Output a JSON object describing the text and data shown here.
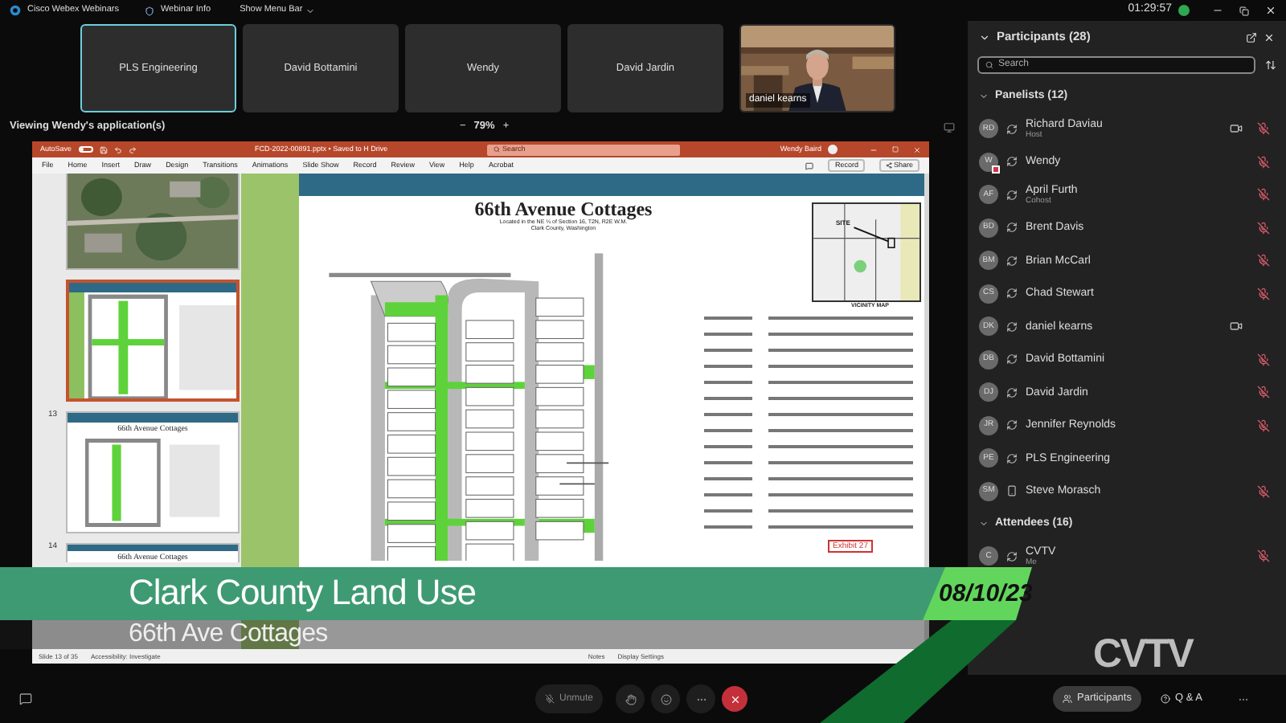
{
  "app_bar": {
    "title": "Cisco Webex Webinars",
    "info": "Webinar Info",
    "menu": "Show Menu Bar",
    "time": "01:29:57"
  },
  "video_tiles": [
    {
      "kind": "name",
      "name": "PLS Engineering",
      "selected": true
    },
    {
      "kind": "name",
      "name": "David Bottamini",
      "selected": false
    },
    {
      "kind": "name",
      "name": "Wendy",
      "selected": false
    },
    {
      "kind": "name",
      "name": "David Jardin",
      "selected": false
    },
    {
      "kind": "video",
      "name": "daniel kearns",
      "selected": false
    }
  ],
  "share_bar": {
    "label": "Viewing Wendy's application(s)",
    "zoom_out": "−",
    "zoom": "79%",
    "zoom_in": "+"
  },
  "ppt": {
    "autosave": "AutoSave",
    "autosave_on": false,
    "file": "FCD-2022-00891.pptx • Saved to H Drive",
    "search": "Search",
    "user": "Wendy Baird",
    "tabs": [
      "File",
      "Home",
      "Insert",
      "Draw",
      "Design",
      "Transitions",
      "Animations",
      "Slide Show",
      "Record",
      "Review",
      "View",
      "Help",
      "Acrobat"
    ],
    "record": "Record",
    "share": "Share",
    "thumbnails": [
      {
        "kind": "aerial",
        "selected": false
      },
      {
        "kind": "plan",
        "selected": true
      },
      {
        "kind": "title",
        "number": "13",
        "title": "66th Avenue Cottages",
        "selected": false
      },
      {
        "kind": "title",
        "number": "14",
        "title": "66th Avenue Cottages",
        "selected": false
      }
    ],
    "slide": {
      "title": "66th Avenue Cottages",
      "subtitle_1": "Located in the NE ¼ of Section 16, T2N, R2E W.M.",
      "subtitle_2": "Clark County, Washington",
      "map_label": "SITE",
      "map_caption": "VICINITY MAP",
      "exhibit": "Exhibit 27"
    },
    "status": {
      "slide": "Slide 13 of 35",
      "accessibility": "Accessibility: Investigate",
      "notes": "Notes",
      "display": "Display Settings"
    }
  },
  "panel": {
    "title": "Participants (28)",
    "search_placeholder": "Search",
    "groups": [
      {
        "label": "Panelists (12)",
        "expanded": true,
        "people": [
          {
            "initials": "RD",
            "name": "Richard Daviau",
            "role": "Host",
            "phone": false,
            "video": true,
            "muted": true,
            "sharing": false
          },
          {
            "initials": "W",
            "name": "Wendy",
            "phone": false,
            "video": false,
            "muted": true,
            "sharing": true
          },
          {
            "initials": "AF",
            "name": "April Furth",
            "role": "Cohost",
            "phone": false,
            "video": false,
            "muted": true,
            "sharing": false
          },
          {
            "initials": "BD",
            "name": "Brent Davis",
            "phone": false,
            "video": false,
            "muted": true,
            "sharing": false
          },
          {
            "initials": "BM",
            "name": "Brian McCarl",
            "phone": false,
            "video": false,
            "muted": true,
            "sharing": false
          },
          {
            "initials": "CS",
            "name": "Chad Stewart",
            "phone": false,
            "video": false,
            "muted": true,
            "sharing": false
          },
          {
            "initials": "DK",
            "name": "daniel kearns",
            "phone": false,
            "video": true,
            "muted": false,
            "sharing": false
          },
          {
            "initials": "DB",
            "name": "David Bottamini",
            "phone": false,
            "video": false,
            "muted": true,
            "sharing": false
          },
          {
            "initials": "DJ",
            "name": "David Jardin",
            "phone": false,
            "video": false,
            "muted": true,
            "sharing": false
          },
          {
            "initials": "JR",
            "name": "Jennifer Reynolds",
            "phone": false,
            "video": false,
            "muted": true,
            "sharing": false
          },
          {
            "initials": "PE",
            "name": "PLS Engineering",
            "phone": false,
            "video": false,
            "muted": false,
            "sharing": false
          },
          {
            "initials": "SM",
            "name": "Steve Morasch",
            "phone": true,
            "video": false,
            "muted": true,
            "sharing": false
          }
        ]
      },
      {
        "label": "Attendees (16)",
        "expanded": true,
        "people": [
          {
            "initials": "C",
            "name": "CVTV",
            "role": "Me",
            "phone": false,
            "video": false,
            "muted": true,
            "sharing": false
          }
        ]
      }
    ]
  },
  "controls": {
    "unmute": "Unmute",
    "tabs": [
      {
        "label": "Participants",
        "selected": true
      },
      {
        "label": "Q & A",
        "selected": false
      }
    ]
  },
  "broadcast": {
    "headline": "Clark County Land Use",
    "subhead": "66th Ave Cottages",
    "date": "08/10/23",
    "logo": "CVTV"
  }
}
